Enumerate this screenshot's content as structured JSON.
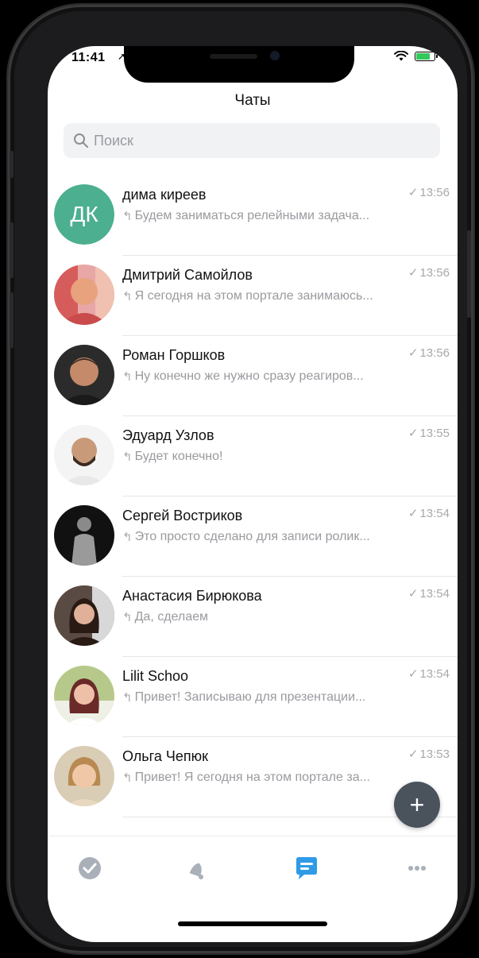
{
  "status": {
    "time": "11:41",
    "location_glyph": "➚",
    "battery_percent": 80
  },
  "header": {
    "title": "Чаты"
  },
  "search": {
    "placeholder": "Поиск"
  },
  "chats": [
    {
      "name": "дима киреев",
      "time": "13:56",
      "preview": "Будем заниматься релейными задача...",
      "initials": "ДК"
    },
    {
      "name": "Дмитрий Самойлов",
      "time": "13:56",
      "preview": "Я сегодня на этом портале занимаюсь..."
    },
    {
      "name": "Роман Горшков",
      "time": "13:56",
      "preview": "Ну конечно же нужно сразу реагиров..."
    },
    {
      "name": "Эдуард Узлов",
      "time": "13:55",
      "preview": "Будет конечно!"
    },
    {
      "name": "Сергей Востриков",
      "time": "13:54",
      "preview": "Это просто сделано для записи ролик..."
    },
    {
      "name": "Анастасия Бирюкова",
      "time": "13:54",
      "preview": "Да, сделаем"
    },
    {
      "name": "Lilit Schoo",
      "time": "13:54",
      "preview": "Привет! Записываю для презентации..."
    },
    {
      "name": "Ольга Чепюк",
      "time": "13:53",
      "preview": "Привет! Я сегодня на этом портале за..."
    }
  ],
  "fab": {
    "label": "+"
  },
  "tabs": [
    {
      "icon": "check-circle-icon"
    },
    {
      "icon": "bell-icon"
    },
    {
      "icon": "chat-bubble-icon"
    },
    {
      "icon": "more-icon"
    }
  ],
  "colors": {
    "accent": "#2f9be6",
    "avatar_initials_bg": "#4caf8f",
    "fab_bg": "#4a525c"
  }
}
